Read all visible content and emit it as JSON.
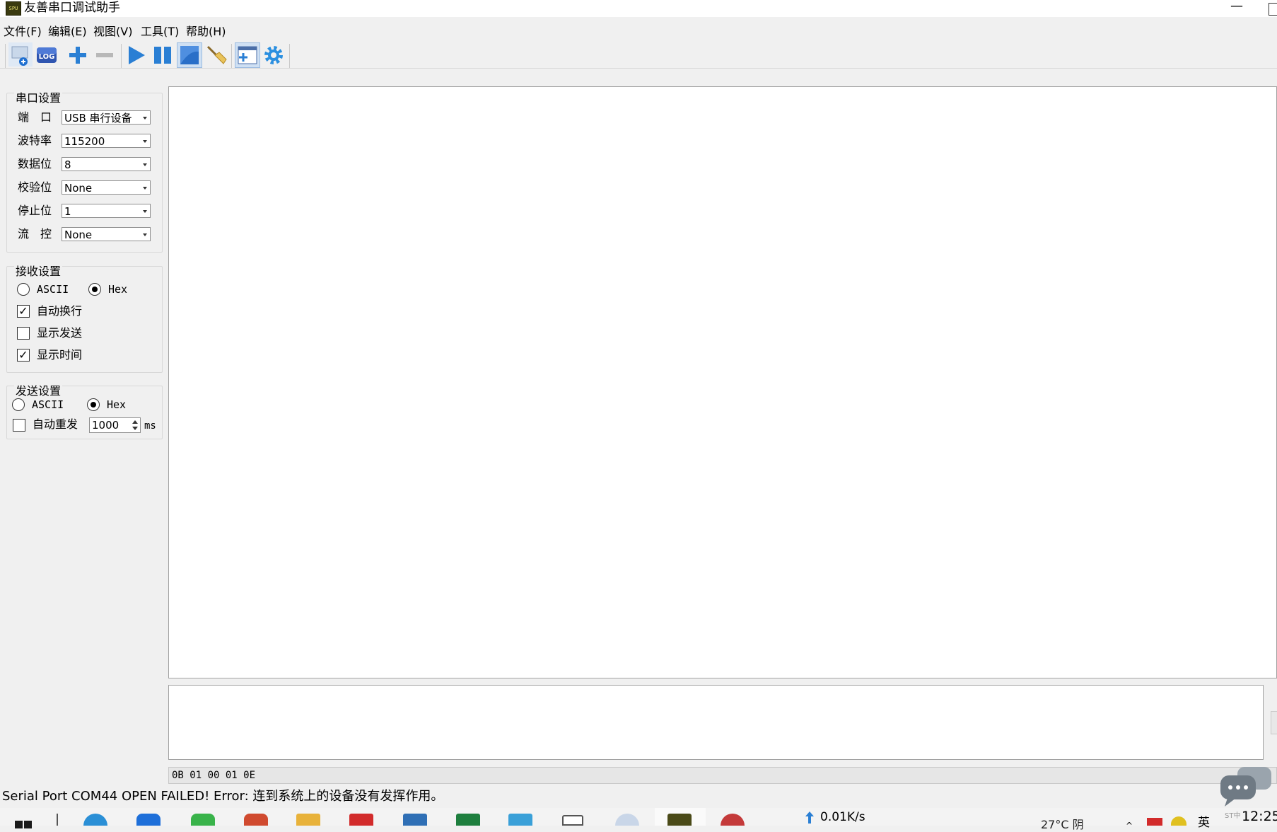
{
  "window": {
    "title": "友善串口调试助手",
    "app_icon_text": "SPU",
    "minimize_glyph": "—"
  },
  "menu": {
    "items": [
      "文件(F)",
      "编辑(E)",
      "视图(V)",
      "工具(T)",
      "帮助(H)"
    ]
  },
  "toolbar": {
    "buttons": [
      {
        "name": "new-session-icon",
        "label": ""
      },
      {
        "name": "log-icon",
        "label": "LOG"
      },
      {
        "name": "add-icon",
        "label": ""
      },
      {
        "name": "remove-icon",
        "label": ""
      },
      {
        "name": "play-icon",
        "label": ""
      },
      {
        "name": "pause-icon",
        "label": ""
      },
      {
        "name": "stop-icon",
        "label": ""
      },
      {
        "name": "clear-broom-icon",
        "label": ""
      },
      {
        "name": "add-window-icon",
        "label": ""
      },
      {
        "name": "settings-gear-icon",
        "label": ""
      }
    ]
  },
  "serial_settings": {
    "title": "串口设置",
    "rows": [
      {
        "label": "端　口",
        "value": "USB 串行设备"
      },
      {
        "label": "波特率",
        "value": "115200"
      },
      {
        "label": "数据位",
        "value": "8"
      },
      {
        "label": "校验位",
        "value": "None"
      },
      {
        "label": "停止位",
        "value": "1"
      },
      {
        "label": "流　控",
        "value": "None"
      }
    ]
  },
  "receive_settings": {
    "title": "接收设置",
    "mode_ascii": "ASCII",
    "mode_hex": "Hex",
    "selected_mode": "Hex",
    "options": [
      {
        "label": "自动换行",
        "checked": true
      },
      {
        "label": "显示发送",
        "checked": false
      },
      {
        "label": "显示时间",
        "checked": true
      }
    ]
  },
  "send_settings": {
    "title": "发送设置",
    "mode_ascii": "ASCII",
    "mode_hex": "Hex",
    "selected_mode": "Hex",
    "auto_resend_label": "自动重发",
    "auto_resend_checked": false,
    "interval_value": "1000",
    "interval_unit": "ms"
  },
  "history": {
    "value": "0B 01 00 01 0E"
  },
  "status": {
    "text": "Serial Port COM44 OPEN FAILED!  Error: 连到系统上的设备没有发挥作用。"
  },
  "taskbar": {
    "netspeed": "0.01K/s",
    "weather": "27°C  阴",
    "lang": "英",
    "watermark": "ST中",
    "clock": "12:25",
    "icon_colors": [
      "#1a1a1a",
      "#2a8fd6",
      "#1e6fd9",
      "#39b34a",
      "#d04a2f",
      "#e8b23a",
      "#d22b2b",
      "#2f6fb5",
      "#1e7f3e",
      "#3aa0d8",
      "#555555",
      "#7a5f9a",
      "#4a4a18",
      "#c43a3a"
    ]
  },
  "colors": {
    "window_bg": "#f0f0f0",
    "text_bg": "#ffffff",
    "toolbar_blue": "#2a7fd4"
  }
}
